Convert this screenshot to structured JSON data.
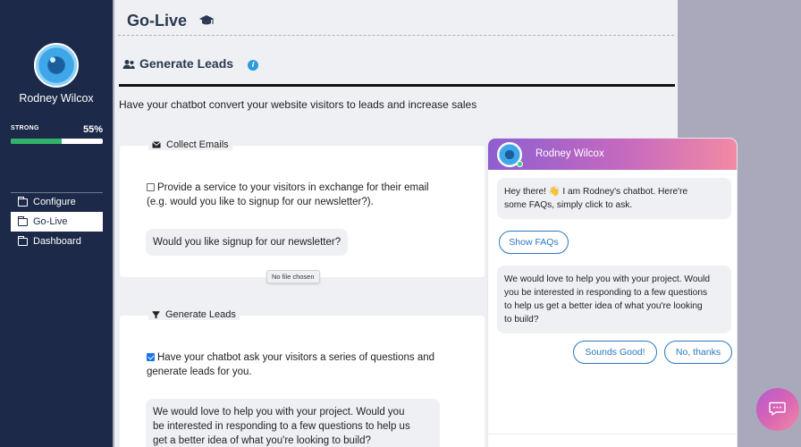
{
  "sidebar": {
    "user_name": "Rodney Wilcox",
    "strength_label": "STRONG",
    "strength_percent_text": "55%",
    "strength_value": 0.55,
    "strength_color": "#30b26a",
    "nav": [
      {
        "label": "Configure",
        "icon": "folder-icon",
        "active": false
      },
      {
        "label": "Go-Live",
        "icon": "folder-icon",
        "active": true
      },
      {
        "label": "Dashboard",
        "icon": "folder-icon",
        "active": false
      }
    ]
  },
  "header": {
    "title": "Go-Live",
    "title_icon": "graduation-cap-icon"
  },
  "section": {
    "icon": "users-icon",
    "title": "Generate Leads",
    "info_glyph": "i",
    "description": "Have your chatbot convert your website visitors to leads and increase sales"
  },
  "collect_emails": {
    "legend": "Collect Emails",
    "legend_icon": "envelope-icon",
    "checked": false,
    "option_text_line1": "Provide a service to your visitors in exchange for their email",
    "option_text_line2": "(e.g. would you like to signup for our newsletter?).",
    "bubble_text": "Would you like signup for our newsletter?",
    "file_status": "No file chosen"
  },
  "generate_leads": {
    "legend": "Generate Leads",
    "legend_icon": "funnel-icon",
    "checked": true,
    "option_text_line1": "Have your chatbot ask your visitors a series of questions and",
    "option_text_line2": "generate leads for you.",
    "bubble_line1": "We would love to help you with your project. Would you",
    "bubble_line2": "be interested in responding to a few questions to help us",
    "bubble_line3": "get a better idea of what you're looking to build?"
  },
  "chat": {
    "bot_name": "Rodney Wilcox",
    "greeting_line1": "Hey there! 👋 I am Rodney's chatbot. Here're",
    "greeting_line2": "some FAQs, simply click to ask.",
    "show_faqs_label": "Show FAQs",
    "lead_line1": "We would love to help you with your project. Would",
    "lead_line2": "you be interested in responding to a few questions",
    "lead_line3": "to help us get a better idea of what you're looking",
    "lead_line4": "to build?",
    "accept_label": "Sounds Good!",
    "decline_label": "No, thanks",
    "header_gradient": [
      "#8e5fd0",
      "#c569bf",
      "#f28aa4"
    ],
    "accent": "#2b78c2"
  },
  "launcher": {
    "icon": "chat-bubble-icon"
  }
}
